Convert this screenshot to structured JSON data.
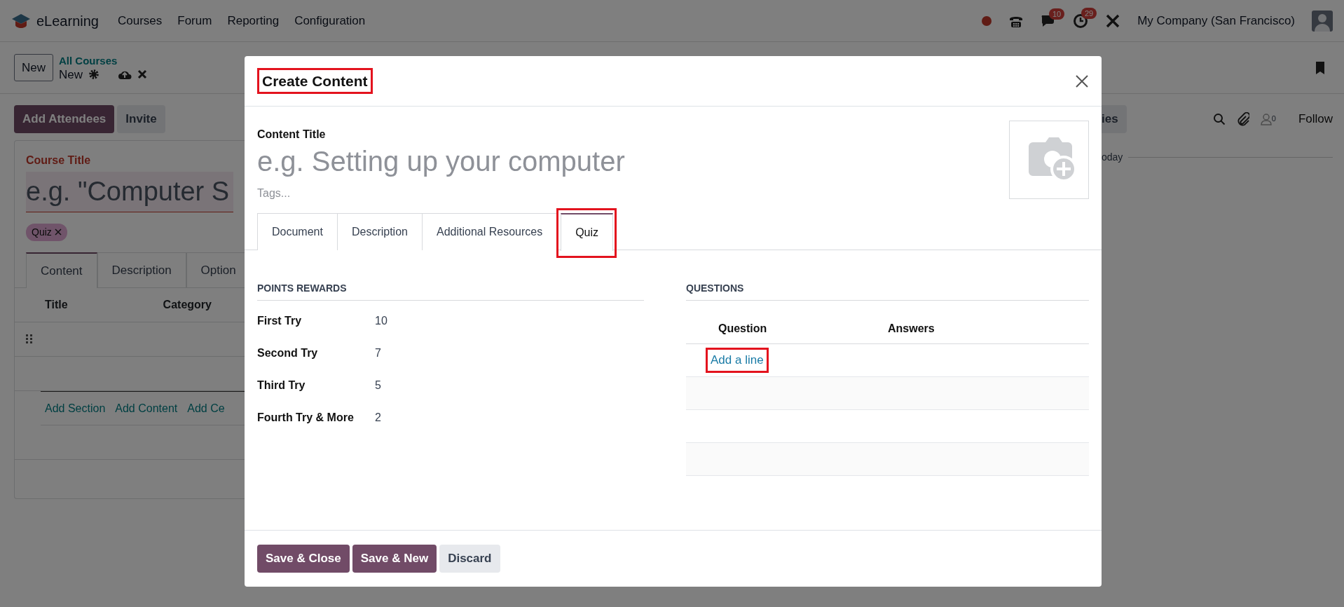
{
  "navbar": {
    "app": "eLearning",
    "menus": [
      "Courses",
      "Forum",
      "Reporting",
      "Configuration"
    ],
    "messages_badge": "10",
    "activities_badge": "29",
    "company": "My Company (San Francisco)"
  },
  "control_panel": {
    "new_button": "New",
    "breadcrumb_parent": "All Courses",
    "breadcrumb_current": "New"
  },
  "form": {
    "buttons": [
      {
        "label": "Add Attendees",
        "kind": "primary"
      },
      {
        "label": "Invite",
        "kind": "secondary"
      }
    ],
    "course_title_label": "Course Title",
    "course_title_placeholder": "e.g. \"Computer S",
    "tags": [
      "Quiz"
    ],
    "tabs": [
      {
        "label": "Content",
        "selected": true
      },
      {
        "label": "Description",
        "selected": false
      },
      {
        "label": "Option",
        "selected": false
      }
    ],
    "columns": [
      "Title",
      "Category"
    ],
    "add_links": [
      "Add Section",
      "Add Content",
      "Add Ce"
    ]
  },
  "chatter": {
    "button_fragment": "ies",
    "follower_count": "0",
    "follow": "Follow",
    "date_fragment": "oday"
  },
  "dialog": {
    "title": {
      "text": "Create Content",
      "highlighted": true
    },
    "content_title_label": "Content Title",
    "content_title_placeholder": "e.g. Setting up your computer",
    "tags_placeholder": "Tags...",
    "tabs": [
      {
        "label": "Document",
        "selected": false,
        "highlighted": false
      },
      {
        "label": "Description",
        "selected": false,
        "highlighted": false
      },
      {
        "label": "Additional Resources",
        "selected": false,
        "highlighted": false
      },
      {
        "label": "Quiz",
        "selected": true,
        "highlighted": true
      }
    ],
    "points_title": "POINTS REWARDS",
    "rewards": [
      {
        "label": "First Try",
        "value": "10"
      },
      {
        "label": "Second Try",
        "value": "7"
      },
      {
        "label": "Third Try",
        "value": "5"
      },
      {
        "label": "Fourth Try & More",
        "value": "2"
      }
    ],
    "questions_title": "QUESTIONS",
    "question_columns": [
      "Question",
      "Answers"
    ],
    "add_line": {
      "label": "Add a line",
      "highlighted": true
    },
    "footer_buttons": [
      {
        "label": "Save & Close",
        "kind": "primary"
      },
      {
        "label": "Save & New",
        "kind": "primary"
      },
      {
        "label": "Discard",
        "kind": "secondary"
      }
    ]
  }
}
